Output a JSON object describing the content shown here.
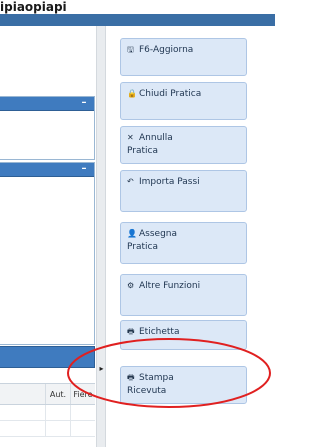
{
  "header": {
    "title": "ipiaopiapi"
  },
  "left": {
    "panel_collapse_symbol": "–",
    "table": {
      "headers": [
        "Aut.",
        "Fiere"
      ]
    }
  },
  "scroll_arrow_symbol": "▸",
  "buttons": [
    {
      "label": "F6-Aggiorna",
      "icon": "save-icon",
      "glyph": "🖫"
    },
    {
      "label": "Chiudi Pratica",
      "icon": "lock-icon",
      "glyph": "🔒"
    },
    {
      "label": "Annulla\nPratica",
      "icon": "close-icon",
      "glyph": "✕"
    },
    {
      "label": "Importa Passi",
      "icon": "undo-icon",
      "glyph": "↶"
    },
    {
      "label": "Assegna\nPratica",
      "icon": "user-icon",
      "glyph": "👤"
    },
    {
      "label": "Altre Funzioni",
      "icon": "gear-icon",
      "glyph": "⚙"
    },
    {
      "label": "Etichetta",
      "icon": "printer-icon",
      "glyph": "🖶"
    },
    {
      "label": "Stampa\nRicevuta",
      "icon": "printer-icon",
      "glyph": "🖶"
    }
  ],
  "colors": {
    "accent": "#3f7bbf",
    "button_bg": "#dce8f7",
    "annotation": "#e02020"
  }
}
